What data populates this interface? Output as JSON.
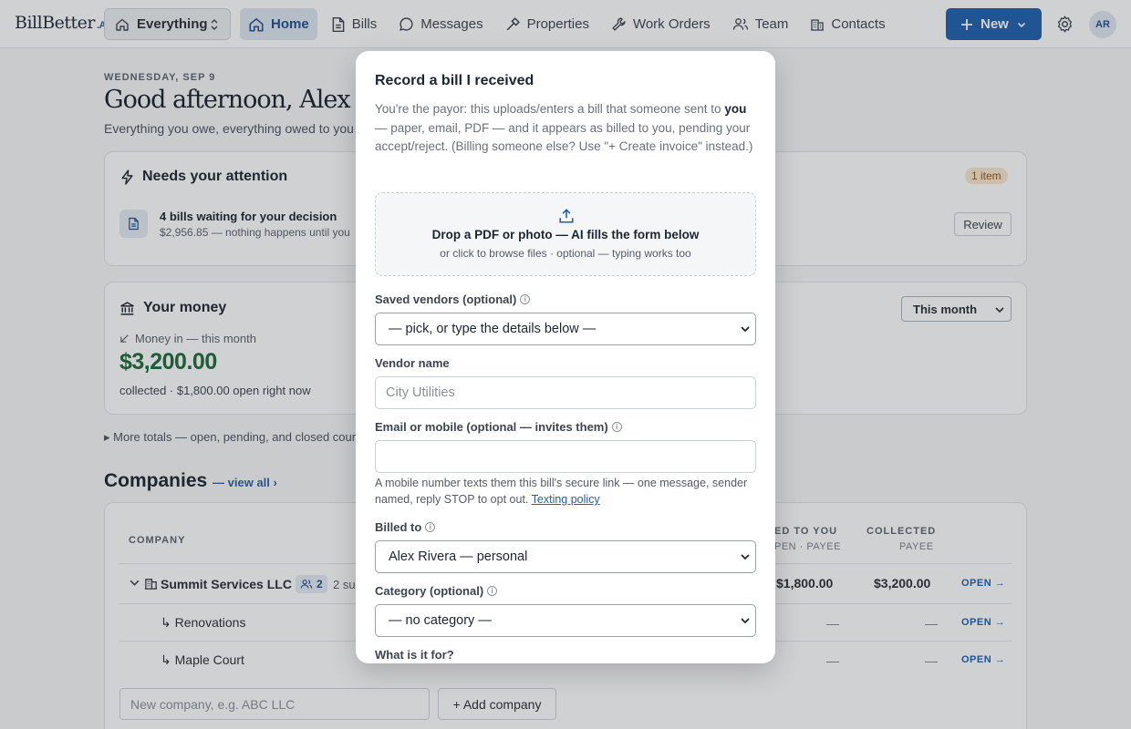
{
  "app": {
    "logo_main": "BillBetter",
    "logo_ai": ".AI"
  },
  "topnav": {
    "scope_label": "Everything",
    "items": [
      {
        "label": "Home",
        "icon": "home-icon",
        "active": true
      },
      {
        "label": "Bills",
        "icon": "document-icon"
      },
      {
        "label": "Messages",
        "icon": "chat-bubble-icon"
      },
      {
        "label": "Properties",
        "icon": "hammer-icon"
      },
      {
        "label": "Work Orders",
        "icon": "wrench-icon"
      },
      {
        "label": "Team",
        "icon": "users-icon"
      },
      {
        "label": "Contacts",
        "icon": "building-icon"
      }
    ],
    "new_label": "New",
    "avatar_initials": "AR",
    "accent": "#1f5fae"
  },
  "dashboard": {
    "date": "WEDNESDAY, SEP 9",
    "greeting": "Good afternoon, Alex",
    "subline": "Everything you owe, everything owed to you",
    "attention": {
      "title": "Needs your attention",
      "count_badge": "1 item",
      "item_title": "4 bills waiting for your decision",
      "item_sub": "$2,956.85 — nothing happens until you",
      "action": "Review"
    },
    "money": {
      "title": "Your money",
      "period": "This month",
      "money_in_label": "Money in — this month",
      "amount": "$3,200.00",
      "sub": "collected · $1,800.00 open right now",
      "amount_color": "#1e6a3a"
    },
    "more_totals": "More totals — open, pending, and closed coun",
    "companies": {
      "heading": "Companies",
      "view_all": "— view all ›",
      "headers": {
        "company": "COMPANY",
        "billed": "ED TO YOU",
        "billed_sub": "PEN · PAYEE",
        "collected": "COLLECTED",
        "collected_sub": "PAYEE"
      },
      "rows": [
        {
          "name": "Summit Services LLC",
          "team_count": "2",
          "subs": "2 su",
          "billed": "$1,800.00",
          "collected": "$3,200.00",
          "link": "OPEN →"
        },
        {
          "name": "↳ Renovations",
          "billed": "—",
          "collected": "—",
          "link": "OPEN →"
        },
        {
          "name": "↳ Maple Court",
          "billed": "—",
          "collected": "—",
          "link": "OPEN →"
        }
      ],
      "new_placeholder": "New company, e.g. ABC LLC",
      "add_label": "+ Add company"
    }
  },
  "modal": {
    "title": "Record a bill I received",
    "desc_1": "You're the payor: this uploads/enters a bill that someone sent to ",
    "desc_bold": "you",
    "desc_2": " — paper, email, PDF — and it appears as billed to you, pending your accept/reject. (Billing someone else? Use \"+ Create invoice\" instead.)",
    "drop_title": "Drop a PDF or photo — AI fills the form below",
    "drop_sub": "or click to browse files · optional — typing works too",
    "saved_vendors_label": "Saved vendors (optional)",
    "saved_vendors_value": "— pick, or type the details below —",
    "vendor_name_label": "Vendor name",
    "vendor_name_placeholder": "City Utilities",
    "contact_label": "Email or mobile (optional — invites them)",
    "contact_value": "",
    "contact_hint": "A mobile number texts them this bill's secure link — one message, sender named, reply STOP to opt out. ",
    "contact_hint_link": "Texting policy",
    "billed_to_label": "Billed to",
    "billed_to_value": "Alex Rivera — personal",
    "category_label": "Category (optional)",
    "category_value": "— no category —",
    "purpose_label": "What is it for?"
  }
}
